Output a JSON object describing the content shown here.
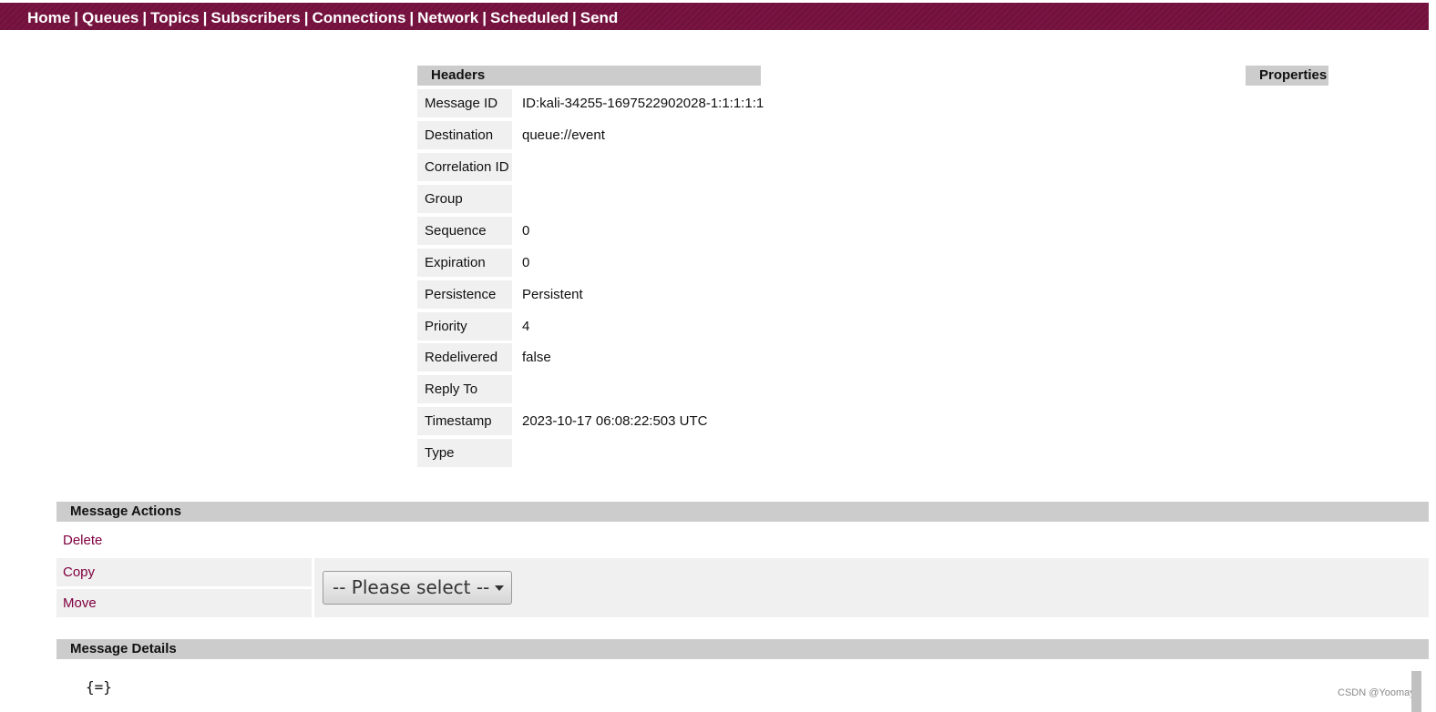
{
  "nav": [
    "Home",
    "Queues",
    "Topics",
    "Subscribers",
    "Connections",
    "Network",
    "Scheduled",
    "Send"
  ],
  "headers": {
    "title": "Headers",
    "rows": [
      {
        "label": "Message ID",
        "value": "ID:kali-34255-1697522902028-1:1:1:1:1"
      },
      {
        "label": "Destination",
        "value": "queue://event"
      },
      {
        "label": "Correlation ID",
        "value": ""
      },
      {
        "label": "Group",
        "value": ""
      },
      {
        "label": "Sequence",
        "value": "0"
      },
      {
        "label": "Expiration",
        "value": "0"
      },
      {
        "label": "Persistence",
        "value": "Persistent"
      },
      {
        "label": "Priority",
        "value": "4"
      },
      {
        "label": "Redelivered",
        "value": "false"
      },
      {
        "label": "Reply To",
        "value": ""
      },
      {
        "label": "Timestamp",
        "value": "2023-10-17 06:08:22:503 UTC"
      },
      {
        "label": "Type",
        "value": ""
      }
    ]
  },
  "properties": {
    "title": "Properties"
  },
  "actions": {
    "title": "Message Actions",
    "delete": "Delete",
    "copy": "Copy",
    "move": "Move",
    "select_value": "-- Please select --"
  },
  "details": {
    "title": "Message Details",
    "body": "{=}"
  },
  "watermark": "CSDN @Yoomay",
  "colors": {
    "nav_bg": "#7a1442",
    "link": "#800040",
    "section_bg": "#cccccc",
    "cell_bg": "#f0f0f0"
  }
}
